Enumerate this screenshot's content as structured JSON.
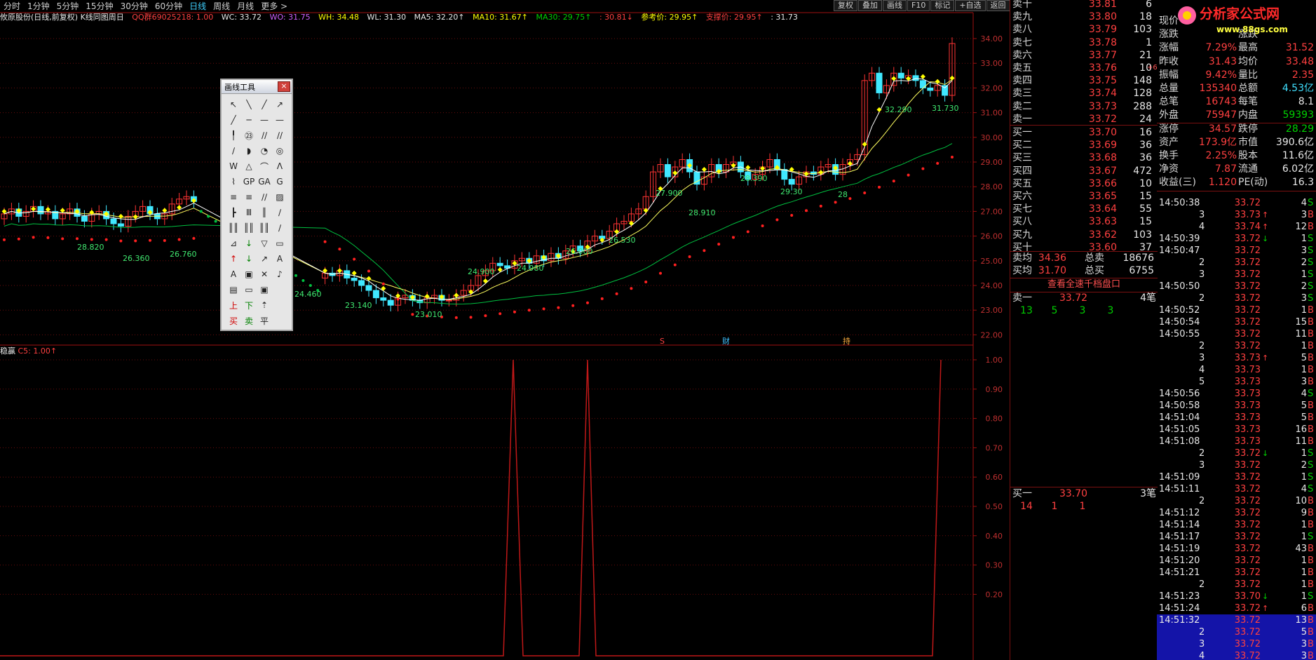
{
  "toolbar": {
    "periods": [
      "分时",
      "1分钟",
      "5分钟",
      "15分钟",
      "30分钟",
      "60分钟",
      "日线",
      "周线",
      "月线",
      "更多 >"
    ],
    "active_period": "日线",
    "right_buttons": [
      "复权",
      "叠加",
      "画线",
      "F10",
      "标记",
      "+自选",
      "返回"
    ]
  },
  "info_line": {
    "title": "攸原股份(日线,前复权) K线同图周日",
    "qq": "QQ群69025218: 1.00",
    "wc": "WC: 33.72",
    "wo": "WO: 31.75",
    "wh": "WH: 34.48",
    "wl": "WL: 31.30",
    "ma5": "MA5: 32.20↑",
    "ma10": "MA10: 31.67↑",
    "ma30": "MA30: 29.75↑",
    "v": ": 30.81↓",
    "ref": "参考价: 29.95↑",
    "support": "支撑价: 29.95↑",
    "last": ": 31.73"
  },
  "sub_info": {
    "label": "稳赢",
    "value": "C5: 1.00↑"
  },
  "price_axis": [
    "34.00",
    "33.00",
    "32.00",
    "31.00",
    "30.00",
    "29.00",
    "28.00",
    "27.00",
    "26.00",
    "25.00",
    "24.00",
    "23.00",
    "22.00"
  ],
  "sub_axis": [
    "1.00",
    "0.90",
    "0.80",
    "0.70",
    "0.60",
    "0.50",
    "0.40",
    "0.30",
    "0.20"
  ],
  "chart_labels": [
    "28.820",
    "26.360",
    "26.760",
    "24.460",
    "23.140",
    "23.010",
    "24.900",
    "24.980",
    "26.000",
    "26.530",
    "27.900",
    "28.910",
    "28.390",
    "29.30",
    "28",
    "32.290",
    "31.730",
    "27"
  ],
  "event_marks": [
    "S",
    "财",
    "持"
  ],
  "draw_tool": {
    "title": "画线工具",
    "close": "×",
    "icons": [
      "↖",
      "╲",
      "╱",
      "↗",
      "╱",
      "─",
      "—",
      "—",
      "╿",
      "㉓",
      "∕∕",
      "∕∕",
      "∕",
      "◗",
      "◔",
      "◎",
      "W",
      "△",
      "⌒",
      "Λ",
      "⌇",
      "GP",
      "GA",
      "G",
      "≡",
      "≡",
      "∕∕",
      "▨",
      "┣",
      "Ⅲ",
      "║",
      "∕",
      "║║",
      "║║",
      "║║",
      "∕",
      "⊿",
      "↓",
      "▽",
      "▭",
      "↑",
      "↓",
      "↗",
      "A",
      "A",
      "▣",
      "✕",
      "♪",
      "▤",
      "▭",
      "▣",
      "",
      "上",
      "下",
      "⇡",
      "",
      "买",
      "卖",
      "平",
      ""
    ]
  },
  "order_book": {
    "asks": [
      {
        "label": "卖十",
        "price": "33.81",
        "vol": "6"
      },
      {
        "label": "卖九",
        "price": "33.80",
        "vol": "18"
      },
      {
        "label": "卖八",
        "price": "33.79",
        "vol": "103"
      },
      {
        "label": "卖七",
        "price": "33.78",
        "vol": "1"
      },
      {
        "label": "卖六",
        "price": "33.77",
        "vol": "21"
      },
      {
        "label": "卖五",
        "price": "33.76",
        "vol": "10",
        "mark": "+6"
      },
      {
        "label": "卖四",
        "price": "33.75",
        "vol": "148"
      },
      {
        "label": "卖三",
        "price": "33.74",
        "vol": "128"
      },
      {
        "label": "卖二",
        "price": "33.73",
        "vol": "288"
      },
      {
        "label": "卖一",
        "price": "33.72",
        "vol": "24"
      }
    ],
    "bids": [
      {
        "label": "买一",
        "price": "33.70",
        "vol": "16"
      },
      {
        "label": "买二",
        "price": "33.69",
        "vol": "36"
      },
      {
        "label": "买三",
        "price": "33.68",
        "vol": "36"
      },
      {
        "label": "买四",
        "price": "33.67",
        "vol": "472"
      },
      {
        "label": "买五",
        "price": "33.66",
        "vol": "10"
      },
      {
        "label": "买六",
        "price": "33.65",
        "vol": "15"
      },
      {
        "label": "买七",
        "price": "33.64",
        "vol": "55"
      },
      {
        "label": "买八",
        "price": "33.63",
        "vol": "15"
      },
      {
        "label": "买九",
        "price": "33.62",
        "vol": "103"
      },
      {
        "label": "买十",
        "price": "33.60",
        "vol": "37"
      }
    ],
    "avg_sell": {
      "label": "卖均",
      "price": "34.36",
      "total_label": "总卖",
      "total": "18676"
    },
    "avg_buy": {
      "label": "买均",
      "price": "31.70",
      "total_label": "总买",
      "total": "6755"
    },
    "depth_button": "查看全速千档盘口",
    "sell1": {
      "label": "卖一",
      "price": "33.72",
      "count": "4笔",
      "splits": [
        "13",
        "5",
        "3",
        "3"
      ]
    },
    "buy1": {
      "label": "买一",
      "price": "33.70",
      "count": "3笔",
      "splits": [
        "14",
        "1",
        "1"
      ]
    }
  },
  "quote": {
    "rows": [
      {
        "a": "现价",
        "b": "",
        "c": "",
        "d": ""
      },
      {
        "a": "涨跌",
        "b": "",
        "c": "涨跌",
        "d": ""
      },
      {
        "a": "涨幅",
        "b": "7.29%",
        "c": "最高",
        "d": "31.52"
      },
      {
        "a": "昨收",
        "b": "31.43",
        "c": "均价",
        "d": "33.48"
      },
      {
        "a": "振幅",
        "b": "9.42%",
        "c": "量比",
        "d": "2.35"
      },
      {
        "a": "总量",
        "b": "135340",
        "c": "总额",
        "d": "4.53亿"
      },
      {
        "a": "总笔",
        "b": "16743",
        "c": "每笔",
        "d": "8.1"
      },
      {
        "a": "外盘",
        "b": "75947",
        "c": "内盘",
        "d": "59393"
      },
      {
        "a": "涨停",
        "b": "34.57",
        "c": "跌停",
        "d": "28.29"
      },
      {
        "a": "资产",
        "b": "173.9亿",
        "c": "市值",
        "d": "390.6亿"
      },
      {
        "a": "换手",
        "b": "2.25%",
        "c": "股本",
        "d": "11.6亿"
      },
      {
        "a": "净资",
        "b": "7.87",
        "c": "流通",
        "d": "6.02亿"
      },
      {
        "a": "收益(三)",
        "b": "1.120",
        "c": "PE(动)",
        "d": "16.3"
      }
    ]
  },
  "logo": {
    "name": "分析家公式网",
    "url": "www.88gs.com"
  },
  "ticks": [
    {
      "t": "14:50:38",
      "p": "33.72",
      "a": "",
      "v": "4",
      "s": "S"
    },
    {
      "t": "3",
      "p": "33.73",
      "a": "↑",
      "v": "3",
      "s": "B"
    },
    {
      "t": "4",
      "p": "33.74",
      "a": "↑",
      "v": "12",
      "s": "B"
    },
    {
      "t": "14:50:39",
      "p": "33.72",
      "a": "↓",
      "v": "1",
      "s": "S"
    },
    {
      "t": "14:50:47",
      "p": "33.72",
      "a": "",
      "v": "3",
      "s": "S"
    },
    {
      "t": "2",
      "p": "33.72",
      "a": "",
      "v": "2",
      "s": "S"
    },
    {
      "t": "3",
      "p": "33.72",
      "a": "",
      "v": "1",
      "s": "S"
    },
    {
      "t": "14:50:50",
      "p": "33.72",
      "a": "",
      "v": "2",
      "s": "S"
    },
    {
      "t": "2",
      "p": "33.72",
      "a": "",
      "v": "3",
      "s": "S"
    },
    {
      "t": "14:50:52",
      "p": "33.72",
      "a": "",
      "v": "1",
      "s": "B"
    },
    {
      "t": "14:50:54",
      "p": "33.72",
      "a": "",
      "v": "15",
      "s": "B"
    },
    {
      "t": "14:50:55",
      "p": "33.72",
      "a": "",
      "v": "11",
      "s": "B"
    },
    {
      "t": "2",
      "p": "33.72",
      "a": "",
      "v": "1",
      "s": "B"
    },
    {
      "t": "3",
      "p": "33.73",
      "a": "↑",
      "v": "5",
      "s": "B"
    },
    {
      "t": "4",
      "p": "33.73",
      "a": "",
      "v": "1",
      "s": "B"
    },
    {
      "t": "5",
      "p": "33.73",
      "a": "",
      "v": "3",
      "s": "B"
    },
    {
      "t": "14:50:56",
      "p": "33.73",
      "a": "",
      "v": "4",
      "s": "S"
    },
    {
      "t": "14:50:58",
      "p": "33.73",
      "a": "",
      "v": "5",
      "s": "B"
    },
    {
      "t": "14:51:04",
      "p": "33.73",
      "a": "",
      "v": "5",
      "s": "B"
    },
    {
      "t": "14:51:05",
      "p": "33.73",
      "a": "",
      "v": "16",
      "s": "B"
    },
    {
      "t": "14:51:08",
      "p": "33.73",
      "a": "",
      "v": "11",
      "s": "B"
    },
    {
      "t": "2",
      "p": "33.72",
      "a": "↓",
      "v": "1",
      "s": "S"
    },
    {
      "t": "3",
      "p": "33.72",
      "a": "",
      "v": "2",
      "s": "S"
    },
    {
      "t": "14:51:09",
      "p": "33.72",
      "a": "",
      "v": "1",
      "s": "S"
    },
    {
      "t": "14:51:11",
      "p": "33.72",
      "a": "",
      "v": "4",
      "s": "S"
    },
    {
      "t": "2",
      "p": "33.72",
      "a": "",
      "v": "10",
      "s": "B"
    },
    {
      "t": "14:51:12",
      "p": "33.72",
      "a": "",
      "v": "9",
      "s": "B"
    },
    {
      "t": "14:51:14",
      "p": "33.72",
      "a": "",
      "v": "1",
      "s": "B"
    },
    {
      "t": "14:51:17",
      "p": "33.72",
      "a": "",
      "v": "1",
      "s": "S"
    },
    {
      "t": "14:51:19",
      "p": "33.72",
      "a": "",
      "v": "43",
      "s": "B"
    },
    {
      "t": "14:51:20",
      "p": "33.72",
      "a": "",
      "v": "1",
      "s": "B"
    },
    {
      "t": "14:51:21",
      "p": "33.72",
      "a": "",
      "v": "1",
      "s": "B"
    },
    {
      "t": "2",
      "p": "33.72",
      "a": "",
      "v": "1",
      "s": "B"
    },
    {
      "t": "14:51:23",
      "p": "33.70",
      "a": "↓",
      "v": "1",
      "s": "S"
    },
    {
      "t": "14:51:24",
      "p": "33.72",
      "a": "↑",
      "v": "6",
      "s": "B"
    },
    {
      "t": "14:51:32",
      "p": "33.72",
      "a": "",
      "v": "13",
      "s": "B",
      "sel": true
    },
    {
      "t": "2",
      "p": "33.72",
      "a": "",
      "v": "5",
      "s": "B",
      "sel": true
    },
    {
      "t": "3",
      "p": "33.72",
      "a": "",
      "v": "3",
      "s": "B",
      "sel": true
    },
    {
      "t": "4",
      "p": "33.72",
      "a": "",
      "v": "3",
      "s": "B",
      "sel": true
    }
  ]
}
